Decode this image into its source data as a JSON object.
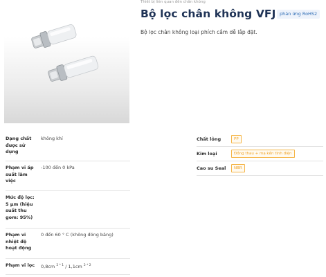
{
  "header": {
    "breadcrumb": "Thiết bị liên quan đến chân không",
    "title": "Bộ lọc chân không VFJ",
    "rohs_badge": "phản ứng RoHS2",
    "description": "Bộ lọc chân không loại phích cắm dễ lắp đặt."
  },
  "specs": [
    {
      "label": "Dạng chất được sử dụng",
      "value": "không khí"
    },
    {
      "label": "Phạm vi áp suất làm việc",
      "value": "-100 đến 0 kPa"
    },
    {
      "label": "Mức độ lọc: 5 μm (hiệu suất thu gom: 95%)",
      "value": ""
    },
    {
      "label": "Phạm vi nhiệt độ hoạt động",
      "value": "0 đến 60 ° C (không đóng băng)"
    },
    {
      "label": "Phạm vi lọc",
      "value_1": "0,8cm",
      "sup_1": "2 * 1",
      "value_sep": " / ",
      "value_2": "1,1cm",
      "sup_2": "2 * 2"
    }
  ],
  "materials": [
    {
      "label": "Chất lỏng",
      "tag": "PP"
    },
    {
      "label": "Kim loại",
      "tag": "Đồng thau + mạ kền tĩnh điện"
    },
    {
      "label": "Cao su Seal",
      "tag": "NBR"
    }
  ],
  "colors": {
    "title": "#1f3356",
    "badge_text": "#2f6db5",
    "tag_border": "#f5b547",
    "tag_text": "#f0a42a"
  }
}
